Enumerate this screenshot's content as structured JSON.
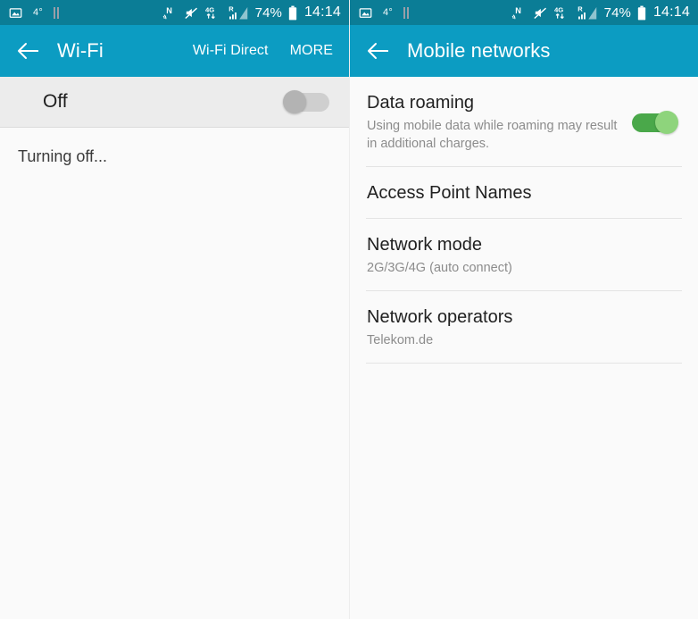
{
  "status_bar": {
    "icons_left": [
      "image-icon",
      "temperature-4deg",
      "pause-bars-icon"
    ],
    "temperature_label": "4°",
    "icons_right": [
      "nfc-icon",
      "sound-mute-icon",
      "4g-data-icon",
      "roaming-signal-icon"
    ],
    "data_network_label": "4G",
    "roaming_label": "R",
    "battery_label": "74%",
    "clock_label": "14:14"
  },
  "left_panel": {
    "appbar": {
      "back_icon": "back-arrow-icon",
      "title": "Wi-Fi",
      "action_direct": "Wi-Fi Direct",
      "action_more": "MORE"
    },
    "switch_row": {
      "label": "Off",
      "state": "off"
    },
    "status_message": "Turning off..."
  },
  "right_panel": {
    "appbar": {
      "back_icon": "back-arrow-icon",
      "title": "Mobile networks"
    },
    "items": [
      {
        "title": "Data roaming",
        "subtitle": "Using mobile data while roaming may result in additional charges.",
        "toggle": "on"
      },
      {
        "title": "Access Point Names",
        "subtitle": ""
      },
      {
        "title": "Network mode",
        "subtitle": "2G/3G/4G (auto connect)"
      },
      {
        "title": "Network operators",
        "subtitle": "Telekom.de"
      }
    ]
  },
  "colors": {
    "appbar": "#0c9cc2",
    "statusbar": "#0b7d96",
    "toggle_on_track": "#4aa84a",
    "toggle_on_knob": "#8ed47c",
    "toggle_off_track": "#cfcfcf",
    "toggle_off_knob": "#b3b3b3",
    "body_bg": "#fafafa",
    "switch_row_bg": "#ececec"
  }
}
